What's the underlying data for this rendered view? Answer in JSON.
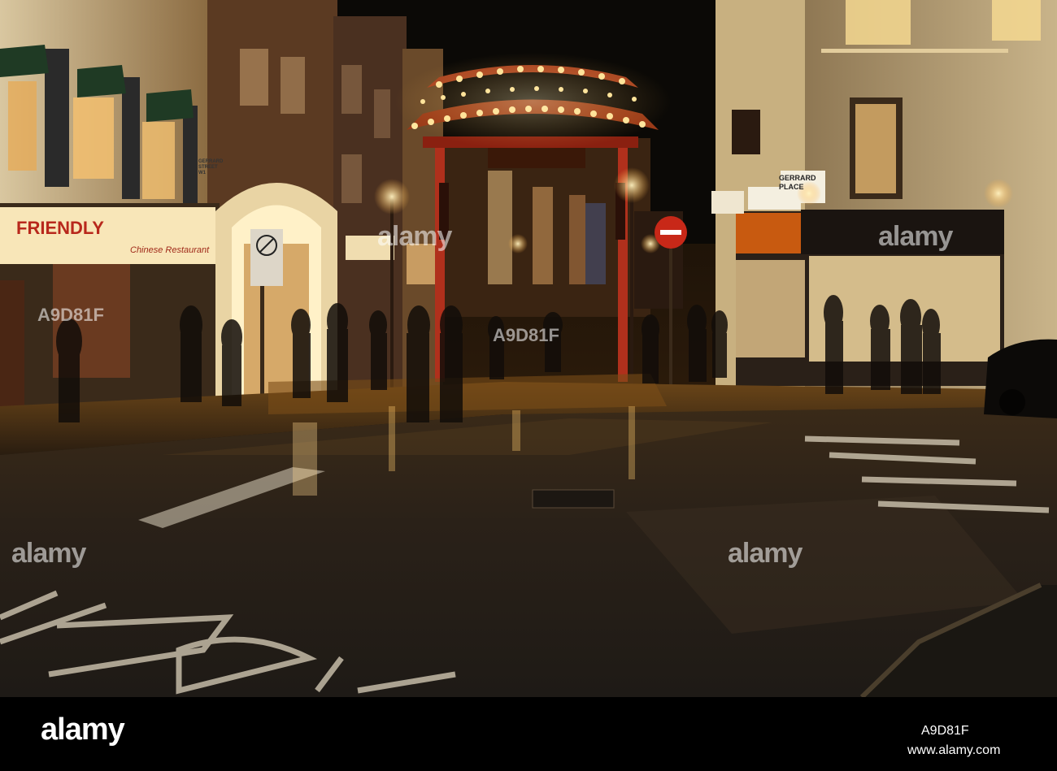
{
  "scene": {
    "description_free": true,
    "signs": {
      "restaurant_name": "FRIENDLY",
      "restaurant_sub": "Chinese Restaurant",
      "street_sign": "GERRARD PLACE",
      "left_street_sign": "GERRARD STREET W1"
    },
    "colors": {
      "lamp_glow": "#ffd27a",
      "road": "#2b241c",
      "gate_red": "#b0301c",
      "shop_sign_red": "#a8180c"
    }
  },
  "watermark": {
    "brand_logo": "alamy",
    "image_id": "A9D81F",
    "site_url": "www.alamy.com"
  }
}
